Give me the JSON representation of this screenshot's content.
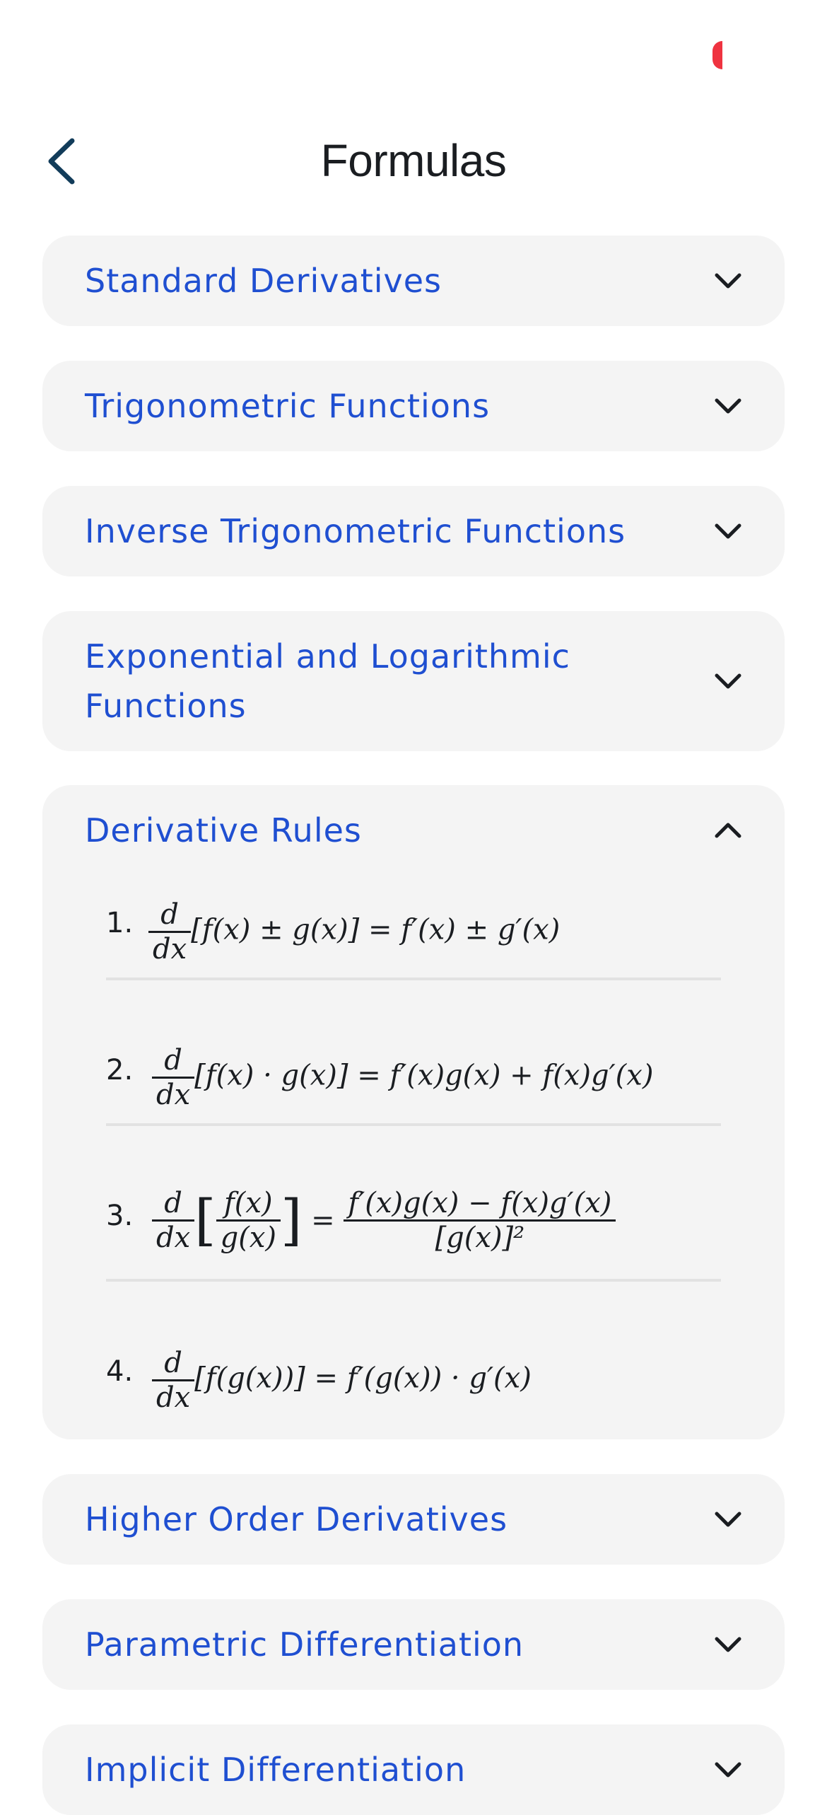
{
  "header": {
    "title": "Formulas"
  },
  "sections": [
    {
      "title": "Standard Derivatives",
      "expanded": false
    },
    {
      "title": "Trigonometric Functions",
      "expanded": false
    },
    {
      "title": "Inverse Trigonometric Functions",
      "expanded": false
    },
    {
      "title": "Exponential and Logarithmic Functions",
      "expanded": false
    },
    {
      "title": "Derivative Rules",
      "expanded": true,
      "rules": [
        {
          "number": "1.",
          "formula_after": "[f(x) ± g(x)] = f′(x) ± g′(x)"
        },
        {
          "number": "2.",
          "formula_after": "[f(x) · g(x)] = f′(x)g(x) + f(x)g′(x)"
        },
        {
          "number": "3.",
          "quot_num": "f(x)",
          "quot_den": "g(x)",
          "rhs_num": "f′(x)g(x) − f(x)g′(x)",
          "rhs_den": "[g(x)]²"
        },
        {
          "number": "4.",
          "formula_after": "[f(g(x))] = f′(g(x)) · g′(x)"
        }
      ],
      "d_num": "d",
      "d_den": "dx",
      "equals": "="
    },
    {
      "title": "Higher Order Derivatives",
      "expanded": false
    },
    {
      "title": "Parametric Differentiation",
      "expanded": false
    },
    {
      "title": "Implicit Differentiation",
      "expanded": false
    }
  ],
  "colors": {
    "accent": "#1f4fd1",
    "card": "#f4f4f4",
    "text": "#1a1d21",
    "status_red": "#ef3340"
  },
  "icons": {
    "back": "chevron-left-icon",
    "collapsed": "chevron-down-icon",
    "expanded": "chevron-up-icon"
  }
}
